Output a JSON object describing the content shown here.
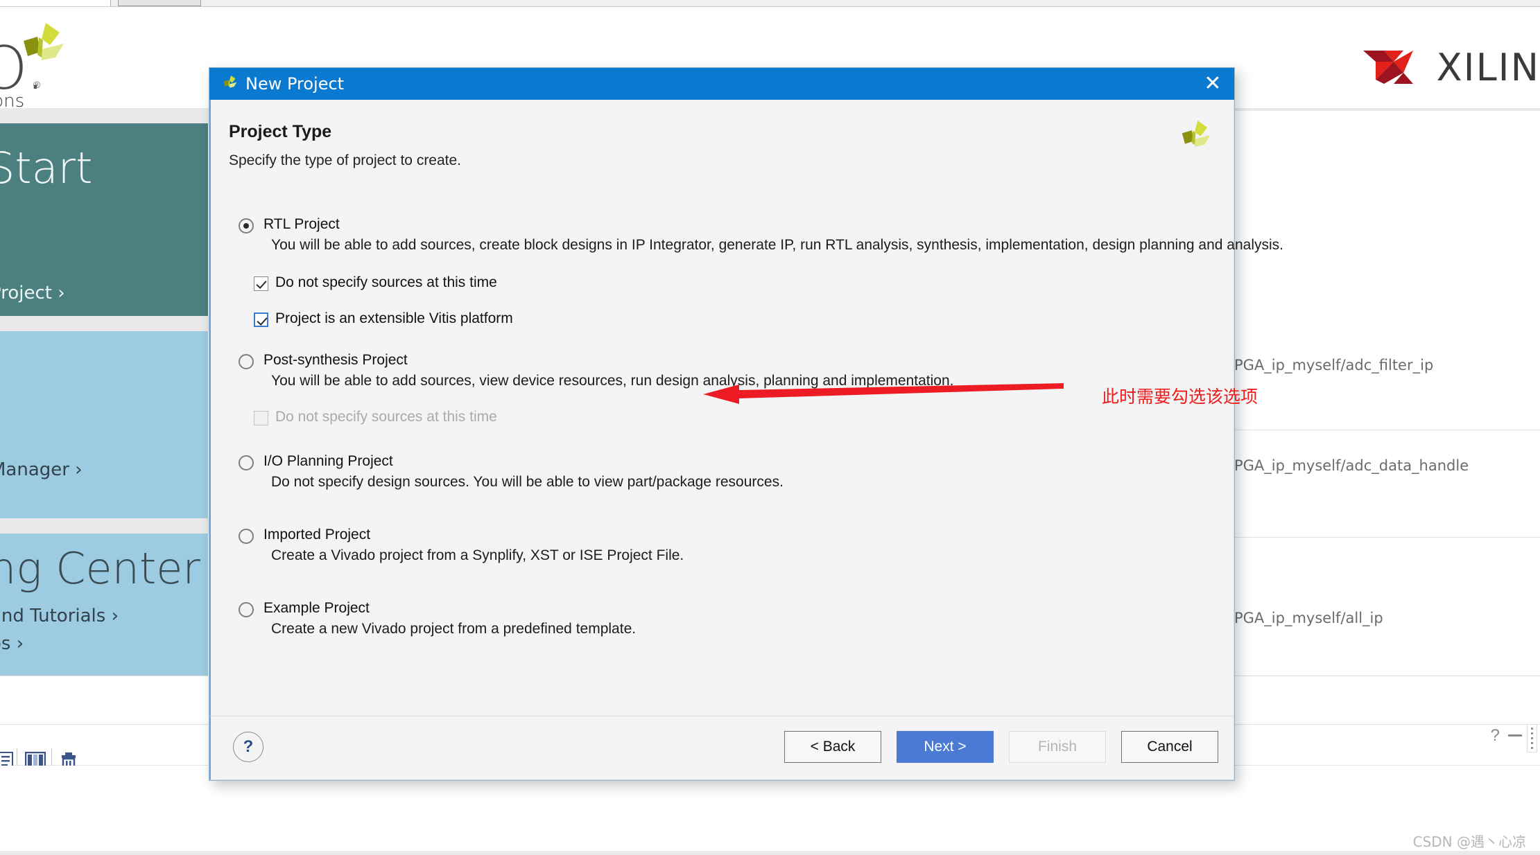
{
  "background": {
    "app_name_fragment": "O.",
    "app_name_registered": "®",
    "app_subtitle_fragment": "ions",
    "brand": "XILIN",
    "vivado_green": "#c8d432",
    "xilinx_red": "#e32119",
    "panels": [
      {
        "title": "Start",
        "links": [
          "›",
          "Project ›"
        ],
        "theme": "teal",
        "color": "#4b7f80"
      },
      {
        "title": "",
        "links": [
          "Manager ›"
        ],
        "theme": "blue",
        "color": "#9ccbe2"
      },
      {
        "title": "ng Center",
        "links": [
          "and Tutorials ›",
          "os ›"
        ],
        "theme": "blue",
        "color": "#9ccbe2"
      }
    ],
    "recent_paths": [
      "PGA_ip_myself/adc_filter_ip",
      "PGA_ip_myself/adc_data_handle",
      "PGA_ip_myself/all_ip"
    ],
    "toolbar_icons": [
      "report-icon",
      "table-icon",
      "trash-icon"
    ],
    "corner_help_icon": "question-icon",
    "corner_minimize_icon": "minimize-icon",
    "corner_more_icon": "more-dots-icon",
    "watermark": "CSDN @遇丶心凉"
  },
  "dialog": {
    "title": "New Project",
    "title_icon": "vivado-logo-icon",
    "close_icon": "close-icon",
    "corner_logo_icon": "vivado-logo-icon",
    "heading": "Project Type",
    "subheading": "Specify the type of project to create.",
    "accent_color": "#0a79d0",
    "options": [
      {
        "id": "rtl-project",
        "label": "RTL Project",
        "accel": "R",
        "selected": true,
        "description": "You will be able to add sources, create block designs in IP Integrator, generate IP, run RTL analysis, synthesis, implementation, design planning and analysis.",
        "checkboxes": [
          {
            "id": "rtl-do-not-specify-sources",
            "label": "Do not specify sources at this time",
            "accel": "D",
            "checked": true,
            "enabled": true,
            "focused": false
          },
          {
            "id": "extensible-vitis-platform",
            "label": "Project is an extensible Vitis platform",
            "accel": "V",
            "checked": true,
            "enabled": true,
            "focused": true
          }
        ]
      },
      {
        "id": "post-synthesis-project",
        "label": "Post-synthesis Project",
        "accel": "P",
        "selected": false,
        "description": "You will be able to add sources, view device resources, run design analysis, planning and implementation.",
        "checkboxes": [
          {
            "id": "post-synth-do-not-specify-sources",
            "label": "Do not specify sources at this time",
            "accel": "o",
            "checked": false,
            "enabled": false,
            "focused": false
          }
        ]
      },
      {
        "id": "io-planning-project",
        "label": "I/O Planning Project",
        "accel": "I",
        "selected": false,
        "description": "Do not specify design sources. You will be able to view part/package resources.",
        "checkboxes": []
      },
      {
        "id": "imported-project",
        "label": "Imported Project",
        "accel": "Im",
        "selected": false,
        "description": "Create a Vivado project from a Synplify, XST or ISE Project File.",
        "checkboxes": []
      },
      {
        "id": "example-project",
        "label": "Example Project",
        "accel": "x",
        "selected": false,
        "description": "Create a new Vivado project from a predefined template.",
        "checkboxes": []
      }
    ],
    "annotation": {
      "text": "此时需要勾选该选项",
      "color": "#f01c1c",
      "arrow_icon": "left-arrow-annotation"
    },
    "footer": {
      "help_label": "?",
      "buttons": [
        {
          "id": "back",
          "label": "< Back",
          "style": "normal"
        },
        {
          "id": "next",
          "label": "Next >",
          "style": "primary"
        },
        {
          "id": "finish",
          "label": "Finish",
          "style": "disabled"
        },
        {
          "id": "cancel",
          "label": "Cancel",
          "style": "normal"
        }
      ]
    }
  }
}
